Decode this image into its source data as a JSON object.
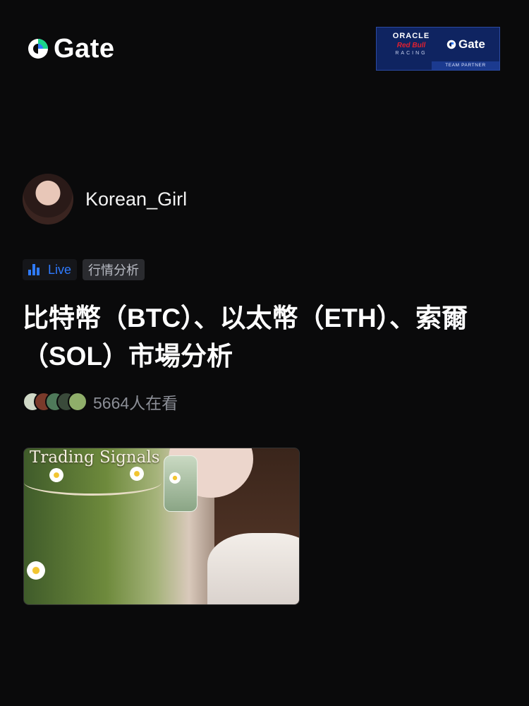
{
  "brand": {
    "name": "Gate",
    "accent": "#2f7bff"
  },
  "partner_badge": {
    "line1": "ORACLE",
    "line2": "Red Bull",
    "line3": "RACING",
    "gate": "Gate",
    "footer": "TEAM PARTNER"
  },
  "author": {
    "name": "Korean_Girl"
  },
  "tags": {
    "live": "Live",
    "category": "行情分析"
  },
  "post": {
    "title": "比特幣（BTC）、以太幣（ETH）、索爾（SOL）市場分析",
    "viewers": "5664人在看"
  },
  "thumbnail": {
    "caption": "Trading Signals"
  },
  "icons": {
    "live": "bar-chart-icon",
    "logo": "gate-logo-icon"
  }
}
